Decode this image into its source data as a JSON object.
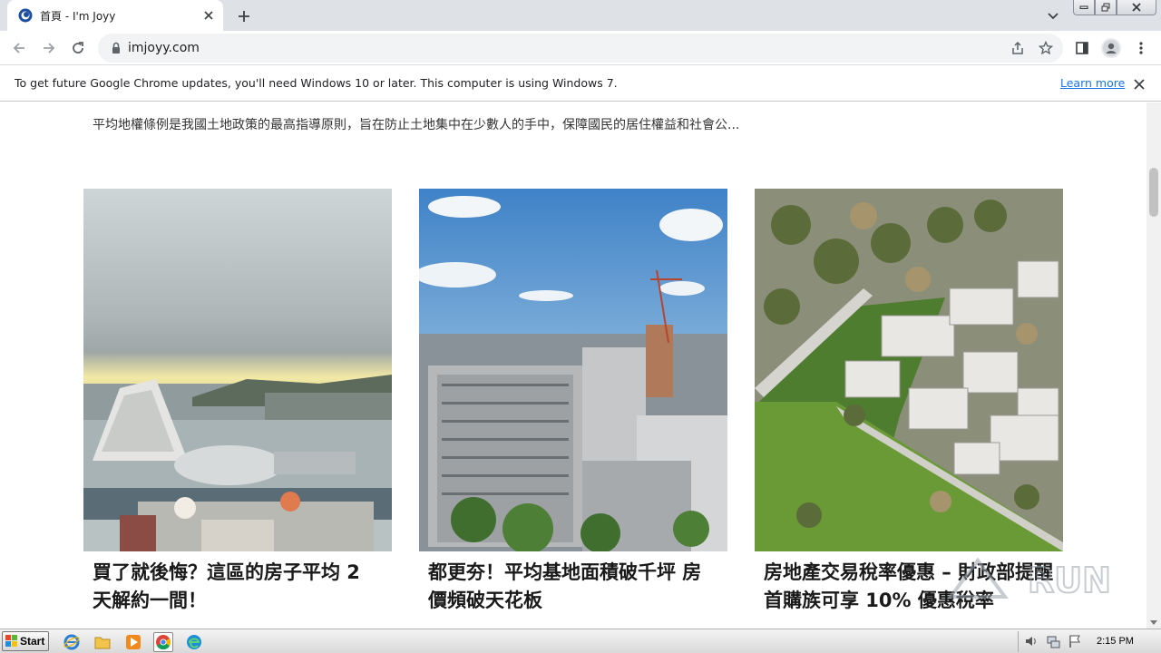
{
  "browser": {
    "tab_title": "首頁 - I'm Joyy",
    "url": "imjoyy.com",
    "infobar_message": "To get future Google Chrome updates, you'll need Windows 10 or later. This computer is using Windows 7.",
    "infobar_link": "Learn more"
  },
  "page": {
    "excerpt": "平均地權條例是我國土地政策的最高指導原則，旨在防止土地集中在少數人的手中，保障國民的居住權益和社會公...",
    "cards": [
      {
        "title": "買了就後悔？這區的房子平均 2 天解約一間！",
        "image": "harbor-city-photo"
      },
      {
        "title": "都更夯！平均基地面積破千坪 房價頻破天花板",
        "image": "highrise-buildings-photo"
      },
      {
        "title": "房地產交易稅率優惠 – 財政部提醒首購族可享 10% 優惠稅率",
        "image": "aerial-houses-photo"
      }
    ]
  },
  "taskbar": {
    "start_label": "Start",
    "clock": "2:15 PM"
  },
  "colors": {
    "tabstrip_bg": "#dee1e6",
    "link_blue": "#1a73e8"
  }
}
